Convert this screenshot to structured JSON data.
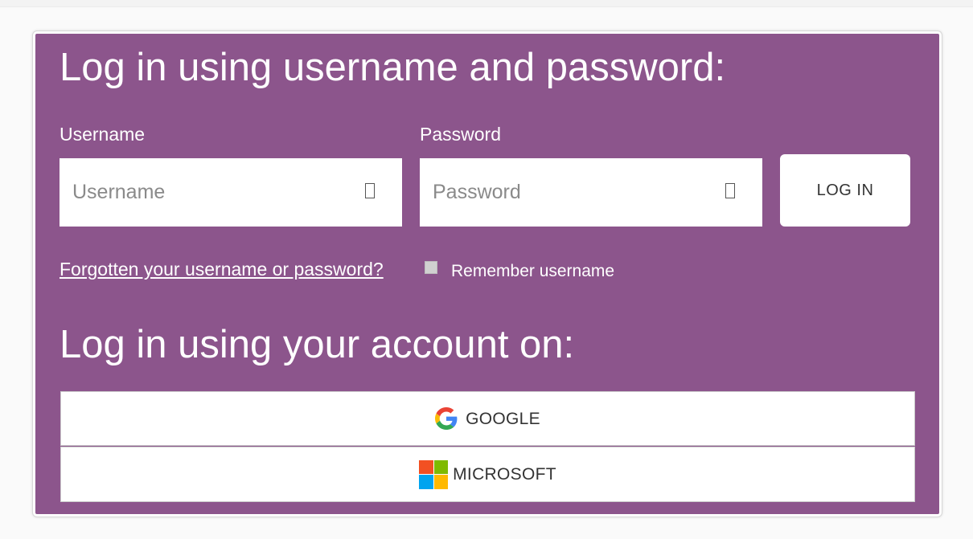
{
  "login_form": {
    "heading": "Log in using username and password:",
    "username_label": "Username",
    "username_placeholder": "Username",
    "username_value": "",
    "password_label": "Password",
    "password_placeholder": "Password",
    "password_value": "",
    "login_button_label": "LOG IN",
    "forgot_link_text": "Forgotten your username or password?",
    "remember_label": "Remember username",
    "remember_checked": false,
    "field_icon": "unknown-glyph-icon"
  },
  "sso": {
    "heading": "Log in using your account on:",
    "providers": [
      {
        "label": "GOOGLE",
        "icon": "google-icon"
      },
      {
        "label": "MICROSOFT",
        "icon": "microsoft-icon"
      }
    ]
  },
  "colors": {
    "panel_background": "#8c558c",
    "button_background": "#ffffff",
    "text_on_panel": "#ffffff",
    "google_blue": "#4285F4",
    "google_red": "#EA4335",
    "google_yellow": "#FBBC05",
    "google_green": "#34A853",
    "ms_red": "#F25022",
    "ms_green": "#7FBA00",
    "ms_blue": "#00A4EF",
    "ms_yellow": "#FFB900"
  }
}
